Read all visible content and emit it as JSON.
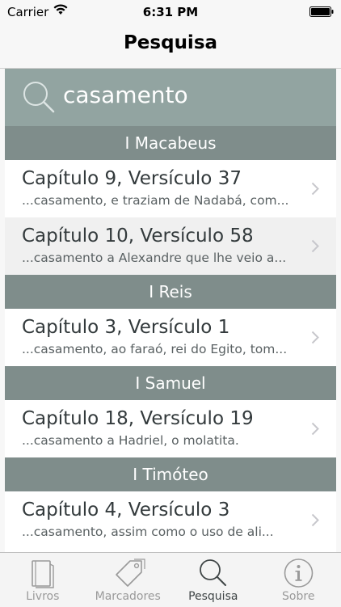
{
  "status": {
    "carrier": "Carrier",
    "time": "6:31 PM"
  },
  "nav": {
    "title": "Pesquisa"
  },
  "search": {
    "query": "casamento"
  },
  "colors": {
    "search_bg": "#92a4a1",
    "section_bg": "#7f8d8b",
    "active_tab": "#3f4546",
    "inactive_tab": "#9a9a9a"
  },
  "sections": [
    {
      "title": "I Macabeus",
      "rows": [
        {
          "title": "Capítulo 9, Versículo 37",
          "snippet": "...casamento, e traziam de Nadabá, com..."
        },
        {
          "title": "Capítulo 10, Versículo 58",
          "snippet": "...casamento a Alexandre que lhe veio a..."
        }
      ]
    },
    {
      "title": "I Reis",
      "rows": [
        {
          "title": "Capítulo 3, Versículo 1",
          "snippet": "...casamento, ao faraó, rei do Egito, tom..."
        }
      ]
    },
    {
      "title": "I Samuel",
      "rows": [
        {
          "title": "Capítulo 18, Versículo 19",
          "snippet": "...casamento a Hadriel, o molatita."
        }
      ]
    },
    {
      "title": "I Timóteo",
      "rows": [
        {
          "title": "Capítulo 4, Versículo 3",
          "snippet": "...casamento, assim como o uso de ali..."
        }
      ]
    }
  ],
  "tabs": [
    {
      "label": "Livros",
      "icon": "book-icon"
    },
    {
      "label": "Marcadores",
      "icon": "tag-icon"
    },
    {
      "label": "Pesquisa",
      "icon": "search-icon",
      "active": true
    },
    {
      "label": "Sobre",
      "icon": "info-icon"
    }
  ]
}
